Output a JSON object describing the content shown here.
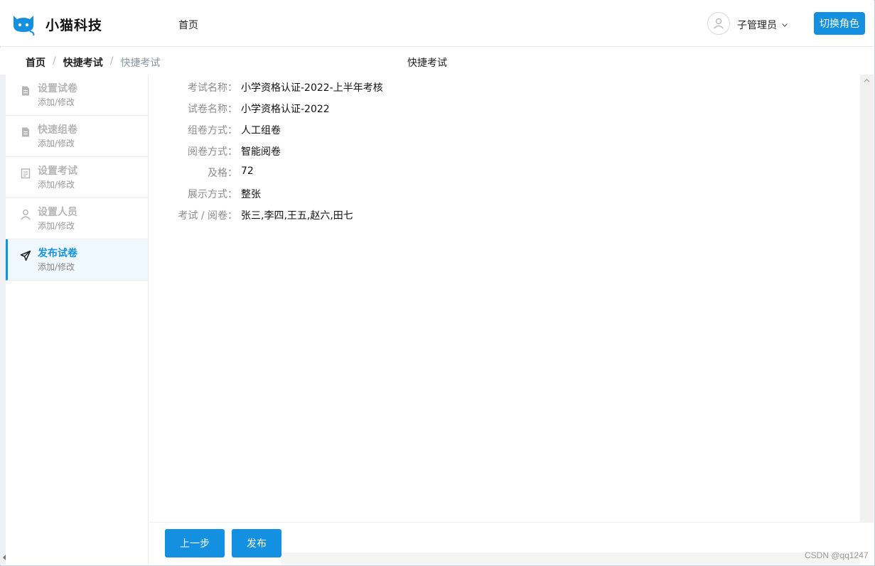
{
  "header": {
    "brand": "小猫科技",
    "nav_home": "首页",
    "user_name": "子管理员",
    "switch_role": "切换角色",
    "brand_color": "#1390e0"
  },
  "breadcrumb": {
    "items": [
      "首页",
      "快捷考试",
      "快捷考试"
    ],
    "separator": "/",
    "page_title": "快捷考试"
  },
  "sidebar": {
    "steps": [
      {
        "title": "设置试卷",
        "sub": "添加/修改",
        "icon": "document-icon",
        "active": false
      },
      {
        "title": "快速组卷",
        "sub": "添加/修改",
        "icon": "document-icon",
        "active": false
      },
      {
        "title": "设置考试",
        "sub": "添加/修改",
        "icon": "calendar-doc-icon",
        "active": false
      },
      {
        "title": "设置人员",
        "sub": "添加/修改",
        "icon": "user-icon",
        "active": false
      },
      {
        "title": "发布试卷",
        "sub": "添加/修改",
        "icon": "send-icon",
        "active": true
      }
    ]
  },
  "details": {
    "rows": [
      {
        "label": "考试名称：",
        "value": "小学资格认证-2022-上半年考核"
      },
      {
        "label": "试卷名称：",
        "value": "小学资格认证-2022"
      },
      {
        "label": "组卷方式：",
        "value": "人工组卷"
      },
      {
        "label": "阅卷方式：",
        "value": "智能阅卷"
      },
      {
        "label": "及格：",
        "value": "72"
      },
      {
        "label": "展示方式：",
        "value": "整张"
      },
      {
        "label": "考试 / 阅卷：",
        "value": "张三,李四,王五,赵六,田七"
      }
    ]
  },
  "footer": {
    "prev": "上一步",
    "publish": "发布",
    "watermark": "CSDN @qq1247"
  }
}
